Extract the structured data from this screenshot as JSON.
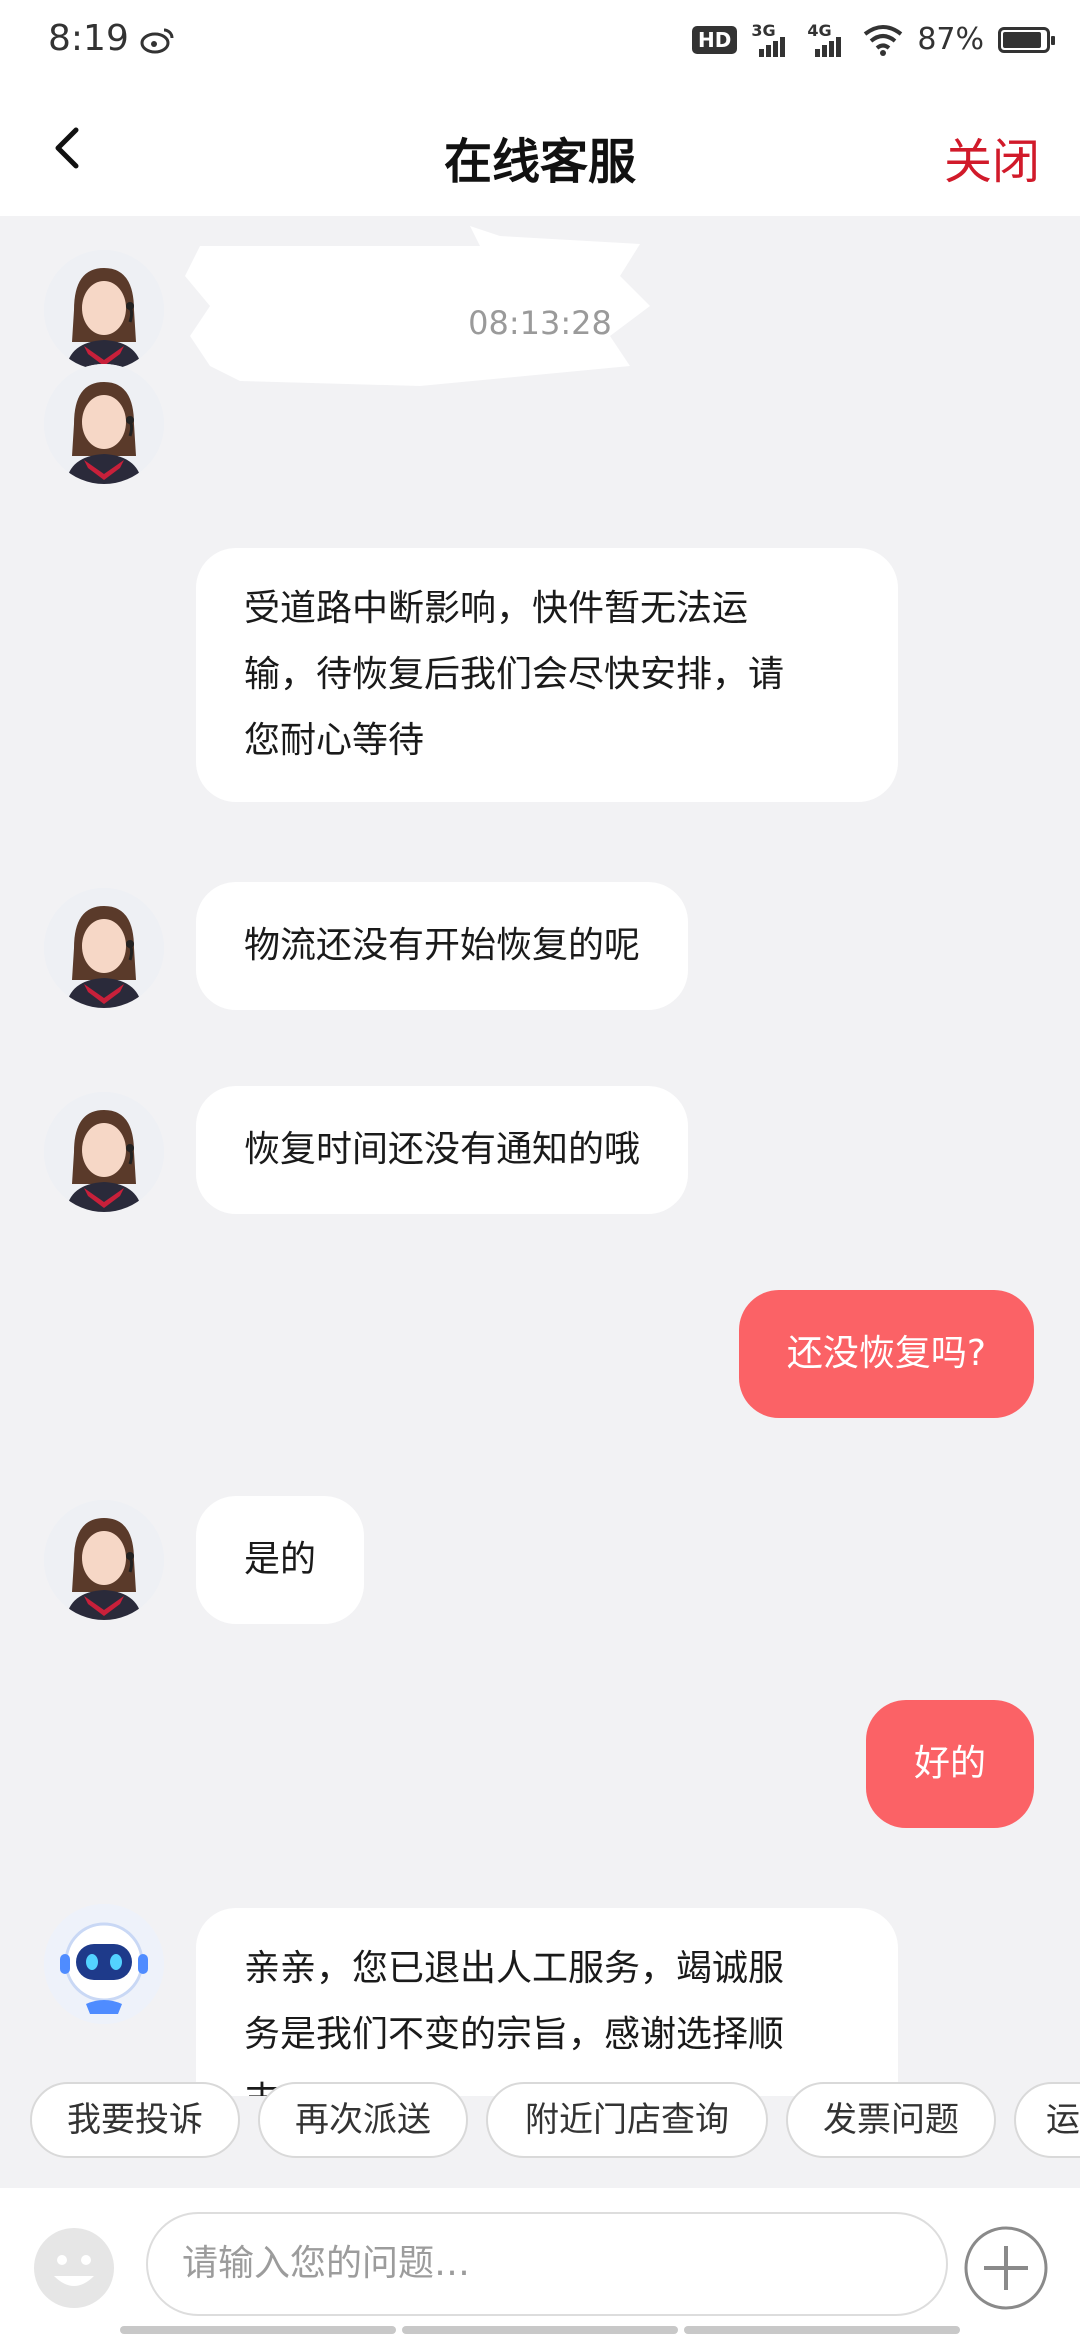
{
  "status_bar": {
    "time": "8:19",
    "network_1": "3G",
    "network_2": "4G",
    "battery": "87%",
    "hd": "HD"
  },
  "header": {
    "title": "在线客服",
    "close_label": "关闭",
    "back_icon": "chevron-left-icon"
  },
  "chat": {
    "timestamp": "08:13:28",
    "messages": [
      {
        "from": "agent",
        "text_lines": [
          "受道路中断影响，快件暂无法运",
          "输，待恢复后我们会尽快安排，请",
          "您耐心等待"
        ]
      },
      {
        "from": "agent",
        "text": "物流还没有开始恢复的呢"
      },
      {
        "from": "agent",
        "text": "恢复时间还没有通知的哦"
      },
      {
        "from": "user",
        "text": "还没恢复吗?"
      },
      {
        "from": "agent",
        "text": "是的"
      },
      {
        "from": "user",
        "text": "好的"
      },
      {
        "from": "bot",
        "text_lines": [
          "亲亲，您已退出人工服务，竭诚服",
          "务是我们不变的宗旨，感谢选择顺",
          "丰"
        ]
      }
    ]
  },
  "quick_replies": [
    "我要投诉",
    "再次派送",
    "附近门店查询",
    "发票问题",
    "运"
  ],
  "input": {
    "placeholder": "请输入您的问题…"
  },
  "colors": {
    "accent": "#d11a2a",
    "user_bubble": "#fb6266",
    "background": "#f2f2f4"
  }
}
